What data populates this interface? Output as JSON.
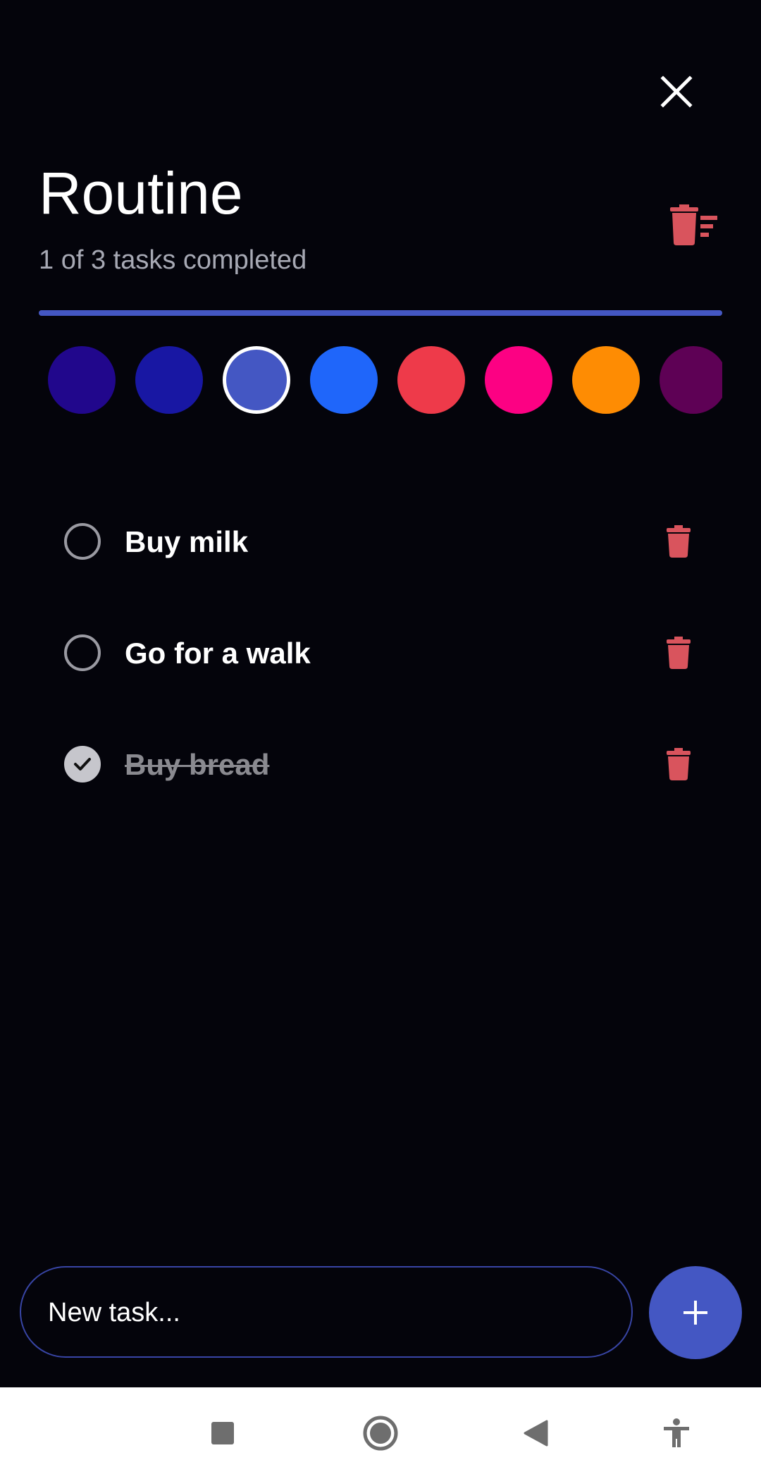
{
  "list": {
    "title": "Routine",
    "summary": "1 of 3 tasks completed",
    "progress_fraction": 1.0,
    "accent_color": "#4457c3"
  },
  "header": {
    "close_icon": "close-icon",
    "clear_completed_icon": "delete-sweep-icon",
    "danger_color": "#d9545d"
  },
  "colors": [
    {
      "name": "indigo",
      "hex": "#21078c",
      "selected": false
    },
    {
      "name": "navy",
      "hex": "#1817a3",
      "selected": false
    },
    {
      "name": "periwinkle",
      "hex": "#4457c3",
      "selected": true
    },
    {
      "name": "blue",
      "hex": "#1f66fa",
      "selected": false
    },
    {
      "name": "red",
      "hex": "#ee3a4a",
      "selected": false
    },
    {
      "name": "magenta",
      "hex": "#fc0183",
      "selected": false
    },
    {
      "name": "orange",
      "hex": "#fe8c03",
      "selected": false
    },
    {
      "name": "purple",
      "hex": "#5e0155",
      "selected": false
    }
  ],
  "tasks": [
    {
      "text": "Buy milk",
      "done": false
    },
    {
      "text": "Go for a walk",
      "done": false
    },
    {
      "text": "Buy bread",
      "done": true
    }
  ],
  "composer": {
    "placeholder": "New task...",
    "add_icon": "plus-icon"
  },
  "navbar": {
    "recents_icon": "square-icon",
    "home_icon": "circle-icon",
    "back_icon": "triangle-back-icon",
    "accessibility_icon": "accessibility-icon",
    "icon_color": "#6e6e6e"
  }
}
